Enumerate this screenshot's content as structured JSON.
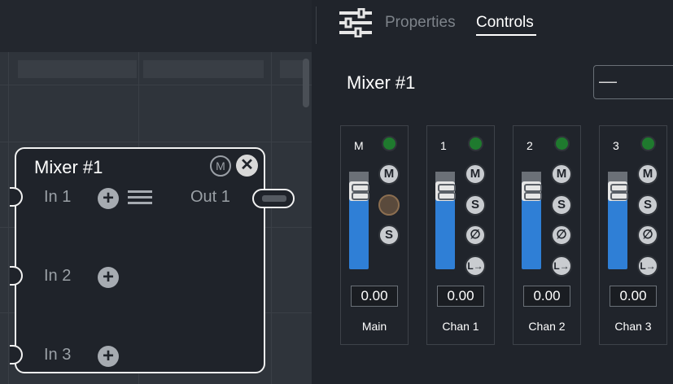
{
  "tabs": {
    "properties": "Properties",
    "controls": "Controls"
  },
  "panel": {
    "title": "Mixer #1",
    "select_value": "—"
  },
  "node": {
    "title": "Mixer #1",
    "mute_label": "M",
    "close_label": "✕",
    "inputs": [
      "In 1",
      "In 2",
      "In 3"
    ],
    "output": "Out 1",
    "plus": "+"
  },
  "strips": [
    {
      "header": "M",
      "name": "Main",
      "value": "0.00",
      "buttons": [
        "M",
        "",
        "S"
      ]
    },
    {
      "header": "1",
      "name": "Chan 1",
      "value": "0.00",
      "buttons": [
        "M",
        "S",
        "∅",
        "L→"
      ]
    },
    {
      "header": "2",
      "name": "Chan 2",
      "value": "0.00",
      "buttons": [
        "M",
        "S",
        "∅",
        "L→"
      ]
    },
    {
      "header": "3",
      "name": "Chan 3",
      "value": "0.00",
      "buttons": [
        "M",
        "S",
        "∅",
        "L→"
      ]
    }
  ],
  "colors": {
    "led": "#1f7a2e",
    "fader": "#2f7fd6",
    "accent": "#ffffff"
  }
}
